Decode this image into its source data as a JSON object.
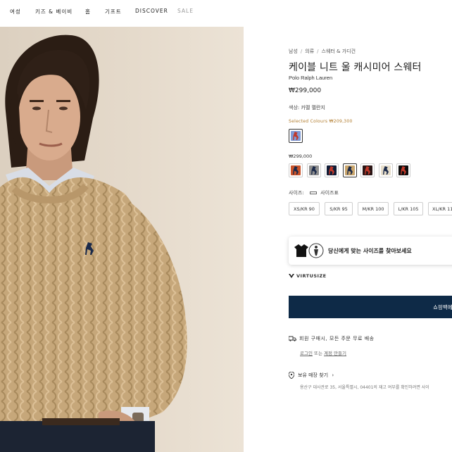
{
  "nav": {
    "items": [
      {
        "label": "여성"
      },
      {
        "label": "키즈 & 베이비"
      },
      {
        "label": "홈"
      },
      {
        "label": "기프트"
      },
      {
        "label": "DISCOVER"
      },
      {
        "label": "SALE"
      }
    ]
  },
  "product": {
    "breadcrumb": [
      "남성",
      "의류",
      "스웨터 & 가디건"
    ],
    "title": "케이블 니트 울 캐시미어 스웨터",
    "brand": "Polo Ralph Lauren",
    "price": "₩299,000",
    "color_label": "색상: 카멜 멜란지",
    "selected_colours_label": "Selected Colours ₩209,300",
    "selected_swatch": {
      "color": "#7f9bd6",
      "pony": "#c0392b"
    },
    "price_label_2": "₩299,000",
    "swatches": [
      {
        "color": "#c9532a",
        "pony": "#1b2a4a"
      },
      {
        "color": "#8e8e8e",
        "pony": "#1b2a4a"
      },
      {
        "color": "#101c36",
        "pony": "#c0392b"
      },
      {
        "color": "#c9a56b",
        "pony": "#1b2a4a"
      },
      {
        "color": "#2a1515",
        "pony": "#c0392b"
      },
      {
        "color": "#e6ddca",
        "pony": "#1b2a4a"
      },
      {
        "color": "#0c0c0c",
        "pony": "#c0392b"
      }
    ],
    "size_label": "사이즈:",
    "size_guide_label": "사이즈표",
    "sizes": [
      {
        "label": "XS/KR 90"
      },
      {
        "label": "S/KR 95"
      },
      {
        "label": "M/KR 100"
      },
      {
        "label": "L/KR 105"
      },
      {
        "label": "XL/KR 11"
      }
    ],
    "virtusize_prompt": "당신에게 맞는 사이즈를 찾아보세요",
    "virtusize_brand": "VIRTUSIZE",
    "add_to_bag": "쇼핑백에",
    "shipping_text": "회원 구매시, 모든 주문 무료 배송",
    "shipping_login": "로그인",
    "shipping_or": " 또는 ",
    "shipping_signup": "계정 만들기",
    "store_finder": "보유 매장 찾기",
    "store_chevron": "›",
    "store_address": "용산구 대사관로 35, 서울특별시, 04401의 재고 여부를 확인하려면 사이"
  },
  "colors": {
    "navy_button": "#0e2a47",
    "sale_grey": "#9a9a9a",
    "gold_text": "#b07a2a",
    "sweater_camel": "#c6a77a"
  }
}
